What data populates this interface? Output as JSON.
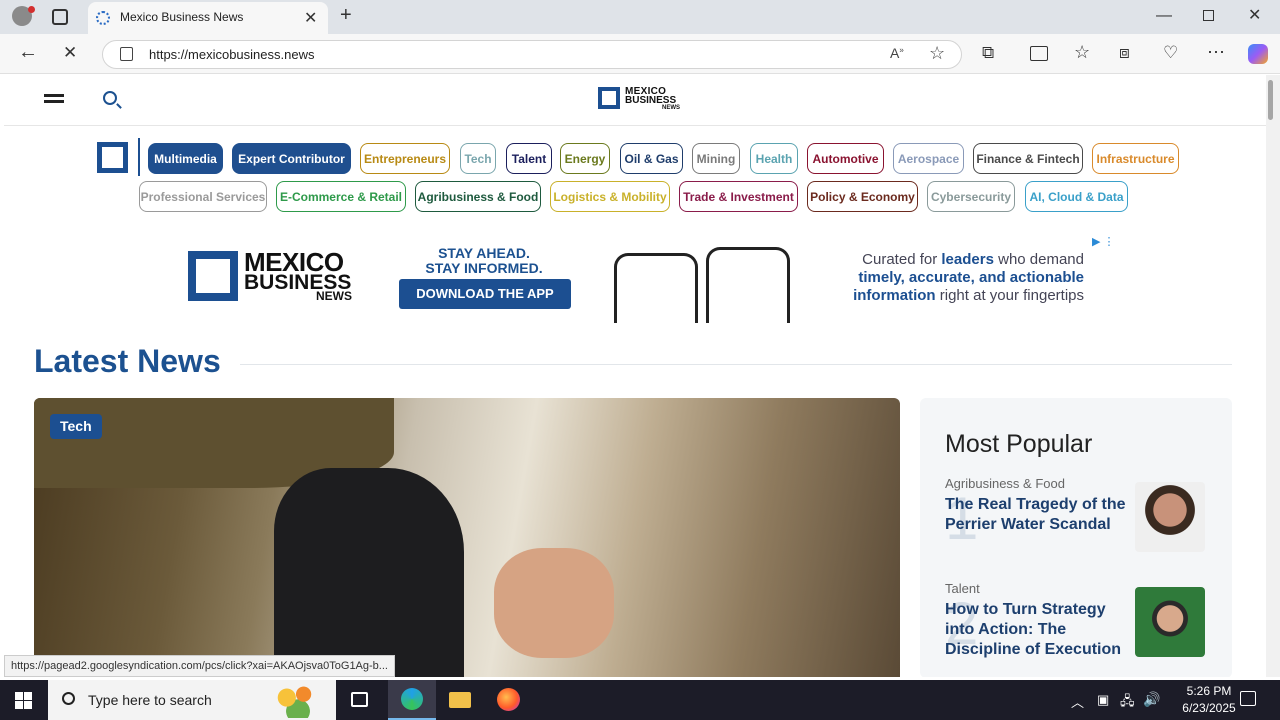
{
  "browser": {
    "tab_title": "Mexico Business News",
    "url": "https://mexicobusiness.news",
    "status_url": "https://pagead2.googlesyndication.com/pcs/click?xai=AKAOjsva0ToG1Ag-b..."
  },
  "site": {
    "logo_line1": "MEXICO",
    "logo_line2": "BUSINESS",
    "logo_line3": "NEWS"
  },
  "categories_row1": [
    {
      "label": "Multimedia",
      "color": "#1f4f8f",
      "filled": true
    },
    {
      "label": "Expert Contributor",
      "color": "#1f4f8f",
      "filled": true
    },
    {
      "label": "Entrepreneurs",
      "color": "#b88a14",
      "filled": false
    },
    {
      "label": "Tech",
      "color": "#7aa6ad",
      "filled": false
    },
    {
      "label": "Talent",
      "color": "#1b1f5c",
      "filled": false
    },
    {
      "label": "Energy",
      "color": "#6b7a1e",
      "filled": false
    },
    {
      "label": "Oil & Gas",
      "color": "#1f3d6b",
      "filled": false
    },
    {
      "label": "Mining",
      "color": "#7a7a7a",
      "filled": false
    },
    {
      "label": "Health",
      "color": "#5aa3b0",
      "filled": false
    },
    {
      "label": "Automotive",
      "color": "#8a1330",
      "filled": false
    },
    {
      "label": "Aerospace",
      "color": "#8a9ab8",
      "filled": false
    },
    {
      "label": "Finance & Fintech",
      "color": "#4a4a4a",
      "filled": false
    },
    {
      "label": "Infrastructure",
      "color": "#d98a2b",
      "filled": false
    }
  ],
  "categories_row2": [
    {
      "label": "Professional Services",
      "color": "#9a9a9a",
      "filled": false
    },
    {
      "label": "E-Commerce & Retail",
      "color": "#2e9a4a",
      "filled": false
    },
    {
      "label": "Agribusiness & Food",
      "color": "#1e5a3e",
      "filled": false
    },
    {
      "label": "Logistics & Mobility",
      "color": "#c9b12a",
      "filled": false
    },
    {
      "label": "Trade & Investment",
      "color": "#8a1c4a",
      "filled": false
    },
    {
      "label": "Policy & Economy",
      "color": "#6b2a1e",
      "filled": false
    },
    {
      "label": "Cybersecurity",
      "color": "#8a9a9a",
      "filled": false
    },
    {
      "label": "AI, Cloud & Data",
      "color": "#3aa0c9",
      "filled": false
    }
  ],
  "ad": {
    "logo_line1": "MEXICO",
    "logo_line2": "BUSINESS",
    "logo_line3": "NEWS",
    "headline1": "STAY AHEAD.",
    "headline2": "STAY INFORMED.",
    "cta": "DOWNLOAD THE APP",
    "copy_pre": "Curated for ",
    "copy_bold1": "leaders",
    "copy_mid": " who demand ",
    "copy_bold2": "timely, accurate, and actionable information",
    "copy_post": " right at your fingertips"
  },
  "latest": {
    "title": "Latest News",
    "hero_badge": "Tech"
  },
  "popular": {
    "title": "Most Popular",
    "items": [
      {
        "rank": "1",
        "category": "Agribusiness & Food",
        "headline": "The Real Tragedy of the Perrier Water Scandal"
      },
      {
        "rank": "2",
        "category": "Talent",
        "headline": "How to Turn Strategy into Action: The Discipline of Execution"
      }
    ]
  },
  "taskbar": {
    "search_placeholder": "Type here to search",
    "time": "5:26 PM",
    "date": "6/23/2025"
  }
}
